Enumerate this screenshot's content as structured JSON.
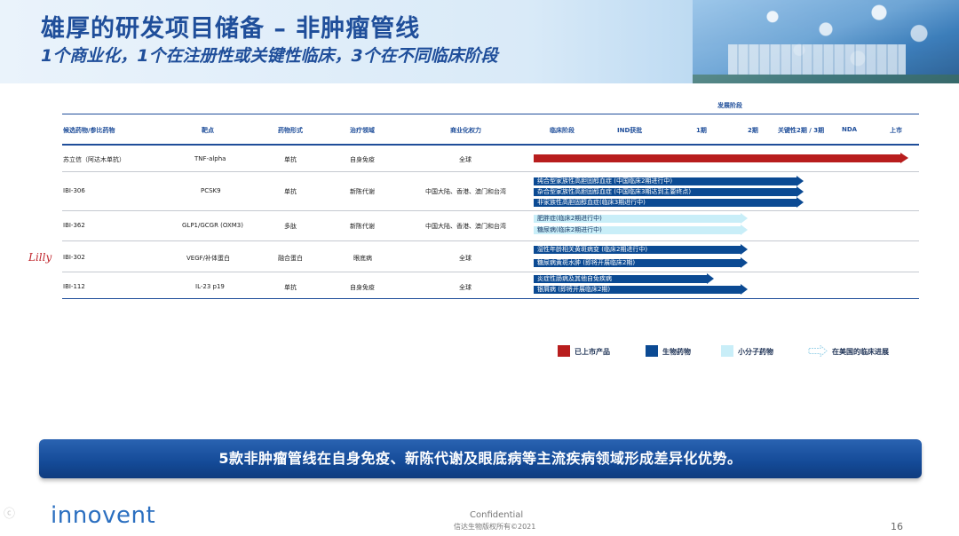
{
  "header": {
    "title": "雄厚的研发项目储备 – 非肿瘤管线",
    "subtitle": "1个商业化，1个在注册性或关键性临床，3个在不同临床阶段"
  },
  "table": {
    "stage_group_label": "发展阶段",
    "columns": [
      "候选药物/参比药物",
      "靶点",
      "药物形式",
      "治疗领域",
      "商业化权力"
    ],
    "stages": [
      "临床阶段",
      "IND获批",
      "1期",
      "2期",
      "关键性2期 / 3期",
      "NDA",
      "上市"
    ],
    "rows": [
      {
        "drug": "苏立信（阿达木单抗）",
        "target": "TNF-alpha",
        "form": "单抗",
        "area": "自身免疫",
        "rights": "全球",
        "bars": [
          {
            "type": "red",
            "label": "",
            "progress": 1.0
          }
        ]
      },
      {
        "drug": "IBI-306",
        "target": "PCSK9",
        "form": "单抗",
        "area": "新陈代谢",
        "rights": "中国大陆、香港、澳门和台湾",
        "bars": [
          {
            "type": "blue",
            "label": "纯合型家族性高胆固醇血症 (中国临床2期进行中)",
            "progress": 0.72
          },
          {
            "type": "blue",
            "label": "杂合型家族性高胆固醇血症 (中国临床3期达到主要终点)",
            "progress": 0.72
          },
          {
            "type": "blue",
            "label": "非家族性高胆固醇血症(临床3期进行中)",
            "progress": 0.72
          }
        ]
      },
      {
        "drug": "IBI-362",
        "target": "GLP1/GCGR (OXM3)",
        "form": "多肽",
        "area": "新陈代谢",
        "rights": "中国大陆、香港、澳门和台湾",
        "bars": [
          {
            "type": "light",
            "label": "肥胖症(临床2期进行中)",
            "progress": 0.57
          },
          {
            "type": "light",
            "label": "糖尿病(临床2期进行中)",
            "progress": 0.57
          }
        ]
      },
      {
        "drug": "IBI-302",
        "target": "VEGF/补体蛋白",
        "form": "融合蛋白",
        "area": "眼底病",
        "rights": "全球",
        "bars": [
          {
            "type": "blue",
            "label": "湿性年龄相关黄斑病变 (临床2期进行中)",
            "progress": 0.57
          },
          {
            "type": "blue",
            "label": "糖尿病黄斑水肿 (即将开展临床2期)",
            "progress": 0.57
          }
        ]
      },
      {
        "drug": "IBI-112",
        "target": "IL-23 p19",
        "form": "单抗",
        "area": "自身免疫",
        "rights": "全球",
        "bars": [
          {
            "type": "blue",
            "label": "炎症性肠病及其他自免疾病",
            "progress": 0.48
          },
          {
            "type": "blue",
            "label": "银屑病 (即将开展临床2期)",
            "progress": 0.57
          }
        ]
      }
    ]
  },
  "legend": {
    "marketed": "已上市产品",
    "biologic": "生物药物",
    "small_molecule": "小分子药物",
    "us_clinical": "在美国的临床进展",
    "colors": {
      "marketed": "#b81d1d",
      "biologic": "#0b4a93",
      "small_molecule": "#c9eef8"
    }
  },
  "banner": {
    "text": "5款非肿瘤管线在自身免疫、新陈代谢及眼底病等主流疾病领域形成差异化优势。"
  },
  "partner_logo": "Lilly",
  "footer": {
    "logo_text": "innovent",
    "confidential": "Confidential",
    "copyright": "信达生物版权所有©2021",
    "page_number": "16"
  }
}
